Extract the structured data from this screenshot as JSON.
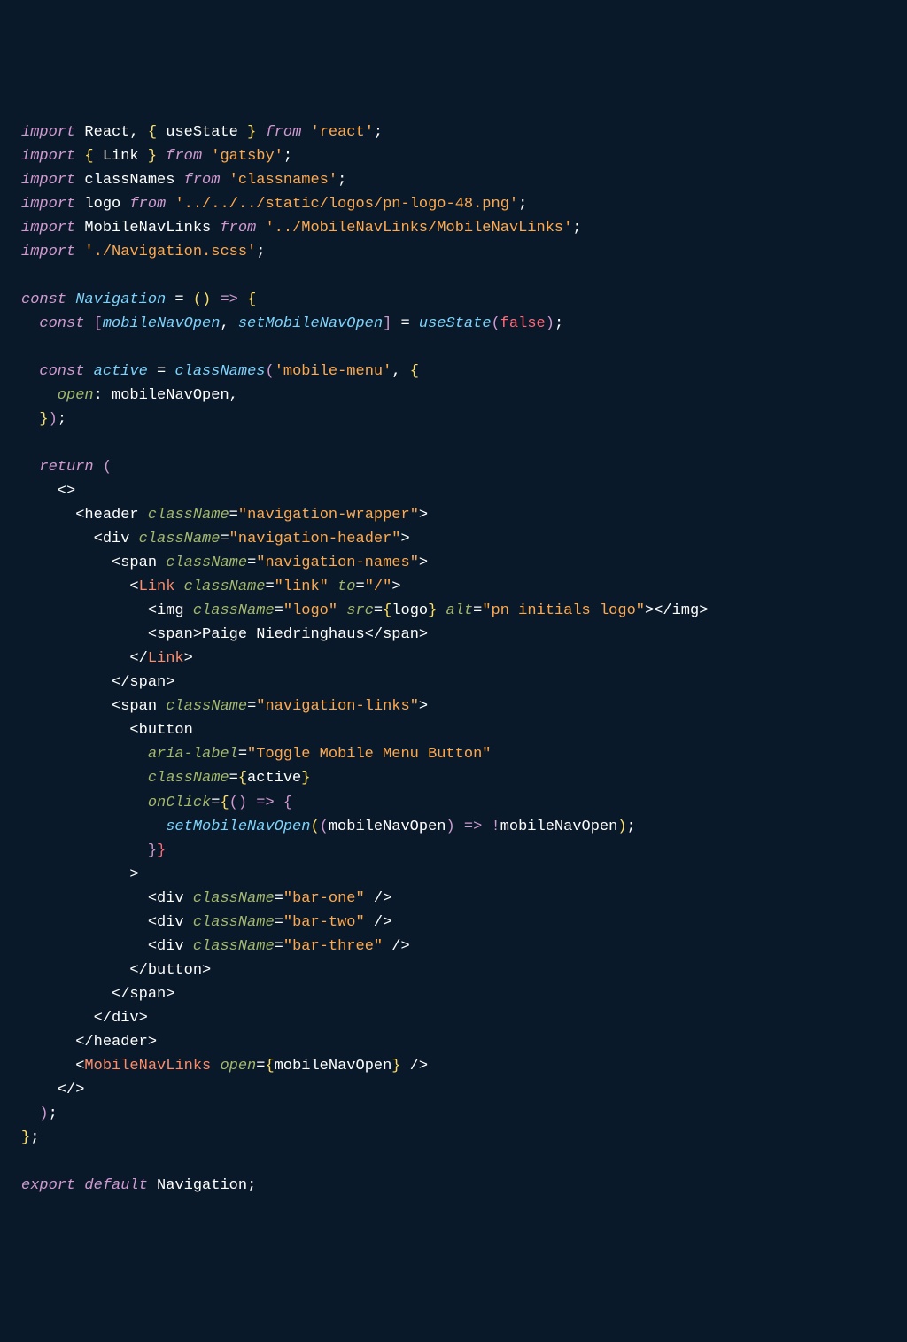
{
  "code": {
    "line1": {
      "import": "import",
      "names": "React, ",
      "brace_o": "{",
      "useState": " useState ",
      "brace_c": "}",
      "from": "from",
      "str": "'react'",
      "semi": ";"
    },
    "line2": {
      "import": "import",
      "brace_o": " {",
      "name": " Link ",
      "brace_c": "} ",
      "from": "from",
      "str": "'gatsby'",
      "semi": ";"
    },
    "line3": {
      "import": "import",
      "name": " classNames ",
      "from": "from",
      "str": "'classnames'",
      "semi": ";"
    },
    "line4": {
      "import": "import",
      "name": " logo ",
      "from": "from",
      "str": "'../../../static/logos/pn-logo-48.png'",
      "semi": ";"
    },
    "line5": {
      "import": "import",
      "name": " MobileNavLinks ",
      "from": "from",
      "str": "'../MobileNavLinks/MobileNavLinks'",
      "semi": ";"
    },
    "line6": {
      "import": "import",
      "str": " './Navigation.scss'",
      "semi": ";"
    },
    "line8": {
      "const": "const",
      "name": " Navigation",
      "eq": " = ",
      "p_o": "(",
      "p_c": ")",
      "arrow": " => ",
      "brace": "{"
    },
    "line9": {
      "const": "  const",
      "b_o": " [",
      "v1": "mobileNavOpen",
      "c1": ", ",
      "v2": "setMobileNavOpen",
      "b_c": "]",
      "eq": " = ",
      "fn": "useState",
      "p_o": "(",
      "val": "false",
      "p_c": ")",
      "semi": ";"
    },
    "line11": {
      "const": "  const",
      "name": " active",
      "eq": " = ",
      "fn": "classNames",
      "p_o": "(",
      "str": "'mobile-menu'",
      "comma": ", ",
      "brace": "{"
    },
    "line12": {
      "prop": "    open",
      "colon": ": ",
      "val": "mobileNavOpen",
      "comma": ","
    },
    "line13": {
      "brace": "  }",
      "p_c": ")",
      "semi": ";"
    },
    "line15": {
      "return": "  return",
      "p_o": " ("
    },
    "line16": {
      "frag": "    <>"
    },
    "line17": {
      "tag_o": "      <",
      "name": "header",
      "attr": " className",
      "eq": "=",
      "str": "\"navigation-wrapper\"",
      "tag_c": ">"
    },
    "line18": {
      "tag_o": "        <",
      "name": "div",
      "attr": " className",
      "eq": "=",
      "str": "\"navigation-header\"",
      "tag_c": ">"
    },
    "line19": {
      "tag_o": "          <",
      "name": "span",
      "attr": " className",
      "eq": "=",
      "str": "\"navigation-names\"",
      "tag_c": ">"
    },
    "line20": {
      "tag_o": "            <",
      "name": "Link",
      "attr1": " className",
      "eq1": "=",
      "str1": "\"link\"",
      "attr2": " to",
      "eq2": "=",
      "str2": "\"/\"",
      "tag_c": ">"
    },
    "line21": {
      "tag_o": "              <",
      "name": "img",
      "attr1": " className",
      "eq1": "=",
      "str1": "\"logo\"",
      "attr2": " src",
      "eq2": "=",
      "jb_o": "{",
      "expr": "logo",
      "jb_c": "}",
      "attr3": " alt",
      "eq3": "=",
      "str3": "\"pn initials logo\"",
      "tag_c": ">",
      "ctag_o": "</",
      "cname": "img",
      "ctag_c": ">"
    },
    "line22": {
      "tag_o": "              <",
      "name": "span",
      "tag_c": ">",
      "text": "Paige Niedringhaus",
      "ctag_o": "</",
      "cname": "span",
      "ctag_c": ">"
    },
    "line23": {
      "ctag_o": "            </",
      "cname": "Link",
      "ctag_c": ">"
    },
    "line24": {
      "ctag_o": "          </",
      "cname": "span",
      "ctag_c": ">"
    },
    "line25": {
      "tag_o": "          <",
      "name": "span",
      "attr": " className",
      "eq": "=",
      "str": "\"navigation-links\"",
      "tag_c": ">"
    },
    "line26": {
      "tag_o": "            <",
      "name": "button"
    },
    "line27": {
      "attr": "              aria-label",
      "eq": "=",
      "str": "\"Toggle Mobile Menu Button\""
    },
    "line28": {
      "attr": "              className",
      "eq": "=",
      "jb_o": "{",
      "expr": "active",
      "jb_c": "}"
    },
    "line29": {
      "attr": "              onClick",
      "eq": "=",
      "jb_o": "{",
      "p_o": "(",
      "p_c": ")",
      "arrow": " => ",
      "brace": "{"
    },
    "line30": {
      "fn": "                setMobileNavOpen",
      "p_o": "(",
      "p_o2": "(",
      "param": "mobileNavOpen",
      "p_c2": ")",
      "arrow": " => ",
      "bang": "!",
      "var": "mobileNavOpen",
      "p_c": ")",
      "semi": ";"
    },
    "line31": {
      "brace": "              }",
      "jb_c": "}"
    },
    "line32": {
      "tag_c": "            >"
    },
    "line33": {
      "tag_o": "              <",
      "name": "div",
      "attr": " className",
      "eq": "=",
      "str": "\"bar-one\"",
      "slash": " /",
      "tag_c": ">"
    },
    "line34": {
      "tag_o": "              <",
      "name": "div",
      "attr": " className",
      "eq": "=",
      "str": "\"bar-two\"",
      "slash": " /",
      "tag_c": ">"
    },
    "line35": {
      "tag_o": "              <",
      "name": "div",
      "attr": " className",
      "eq": "=",
      "str": "\"bar-three\"",
      "slash": " /",
      "tag_c": ">"
    },
    "line36": {
      "ctag_o": "            </",
      "cname": "button",
      "ctag_c": ">"
    },
    "line37": {
      "ctag_o": "          </",
      "cname": "span",
      "ctag_c": ">"
    },
    "line38": {
      "ctag_o": "        </",
      "cname": "div",
      "ctag_c": ">"
    },
    "line39": {
      "ctag_o": "      </",
      "cname": "header",
      "ctag_c": ">"
    },
    "line40": {
      "tag_o": "      <",
      "name": "MobileNavLinks",
      "attr": " open",
      "eq": "=",
      "jb_o": "{",
      "expr": "mobileNavOpen",
      "jb_c": "}",
      "slash": " /",
      "tag_c": ">"
    },
    "line41": {
      "frag": "    </>"
    },
    "line42": {
      "p_c": "  )",
      "semi": ";"
    },
    "line43": {
      "brace": "}",
      "semi": ";"
    },
    "line45": {
      "export": "export",
      "default": " default",
      "name": " Navigation",
      "semi": ";"
    }
  }
}
